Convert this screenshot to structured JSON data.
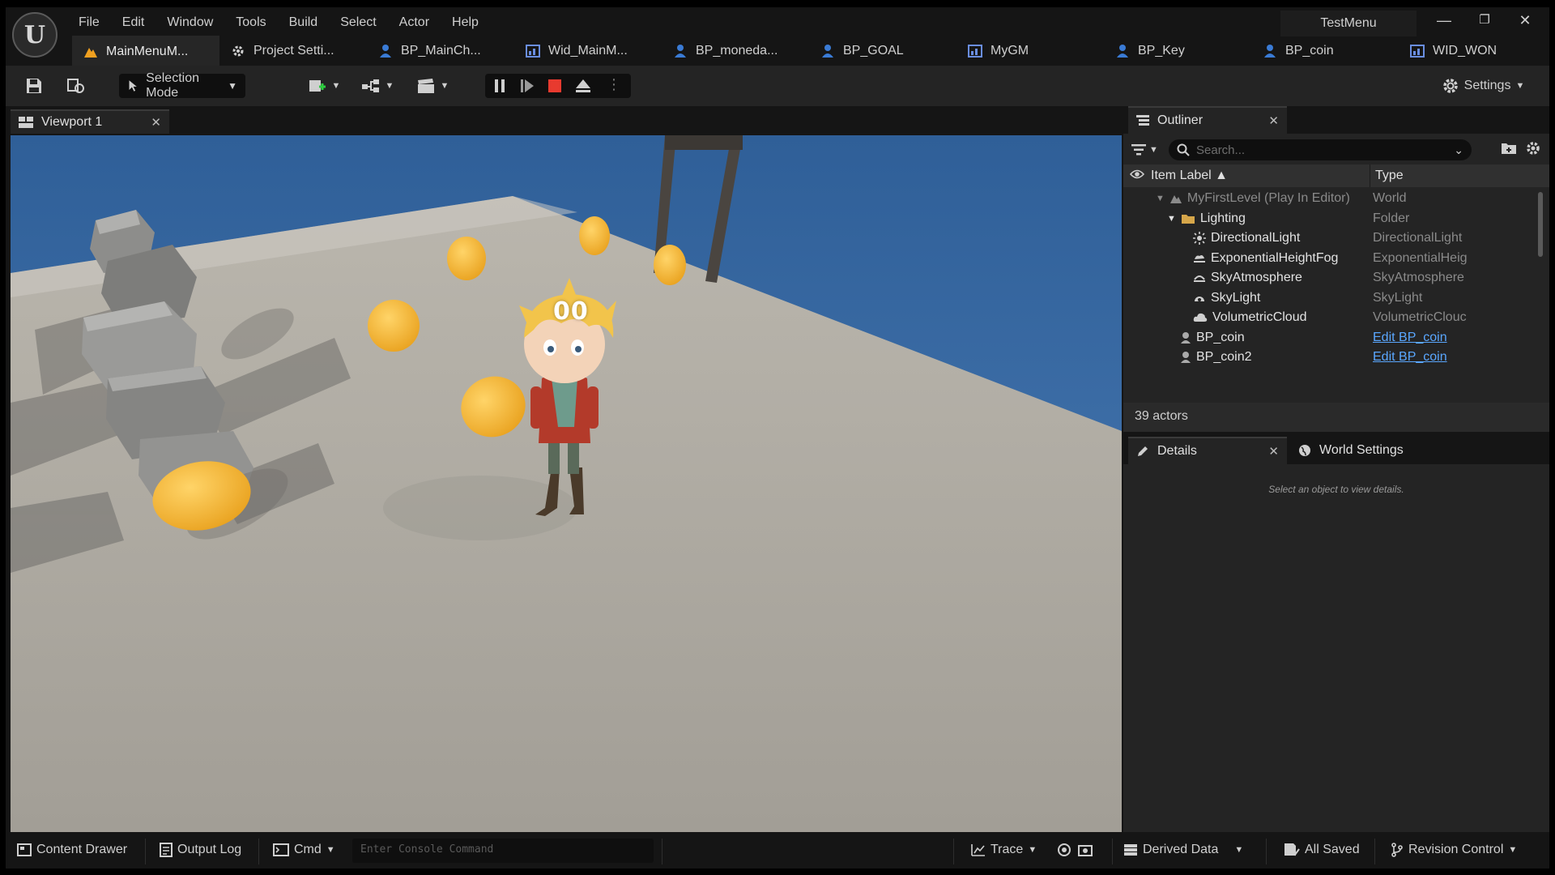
{
  "app": {
    "project_name": "TestMenu",
    "menu": [
      "File",
      "Edit",
      "Window",
      "Tools",
      "Build",
      "Select",
      "Actor",
      "Help"
    ],
    "tabs": [
      {
        "label": "MainMenuM...",
        "icon": "level-icon",
        "active": true
      },
      {
        "label": "Project Setti...",
        "icon": "settings-gear-icon",
        "active": false
      },
      {
        "label": "BP_MainCh...",
        "icon": "blueprint-icon",
        "active": false
      },
      {
        "label": "Wid_MainM...",
        "icon": "widget-icon",
        "active": false
      },
      {
        "label": "BP_moneda...",
        "icon": "blueprint-icon",
        "active": false
      },
      {
        "label": "BP_GOAL",
        "icon": "blueprint-icon",
        "active": false
      },
      {
        "label": "MyGM",
        "icon": "widget-icon",
        "active": false
      },
      {
        "label": "BP_Key",
        "icon": "blueprint-icon",
        "active": false
      },
      {
        "label": "BP_coin",
        "icon": "blueprint-icon",
        "active": false
      },
      {
        "label": "WID_WON",
        "icon": "widget-icon",
        "active": false
      }
    ]
  },
  "toolbar": {
    "selection_mode": "Selection Mode",
    "settings": "Settings"
  },
  "viewport": {
    "tab_label": "Viewport 1",
    "coin_counter": "00"
  },
  "outliner": {
    "tab_label": "Outliner",
    "search_placeholder": "Search...",
    "col_label": "Item Label ▲",
    "col_type": "Type",
    "rows": [
      {
        "label": "MyFirstLevel (Play In Editor)",
        "type": "World",
        "icon": "level-icon",
        "indent": 0,
        "expander": true,
        "dim": true,
        "link": false
      },
      {
        "label": "Lighting",
        "type": "Folder",
        "icon": "folder-icon",
        "indent": 1,
        "expander": true,
        "dim": false,
        "link": false
      },
      {
        "label": "DirectionalLight",
        "type": "DirectionalLight",
        "icon": "sun-icon",
        "indent": 2,
        "expander": false,
        "dim": false,
        "link": false
      },
      {
        "label": "ExponentialHeightFog",
        "type": "ExponentialHeig",
        "icon": "fog-icon",
        "indent": 2,
        "expander": false,
        "dim": false,
        "link": false
      },
      {
        "label": "SkyAtmosphere",
        "type": "SkyAtmosphere",
        "icon": "sky-atmosphere-icon",
        "indent": 2,
        "expander": false,
        "dim": false,
        "link": false
      },
      {
        "label": "SkyLight",
        "type": "SkyLight",
        "icon": "skylight-icon",
        "indent": 2,
        "expander": false,
        "dim": false,
        "link": false
      },
      {
        "label": "VolumetricCloud",
        "type": "VolumetricClouc",
        "icon": "cloud-icon",
        "indent": 2,
        "expander": false,
        "dim": false,
        "link": false
      },
      {
        "label": "BP_coin",
        "type": "Edit BP_coin",
        "icon": "actor-icon",
        "indent": 1,
        "expander": false,
        "dim": false,
        "link": true
      },
      {
        "label": "BP_coin2",
        "type": "Edit BP_coin",
        "icon": "actor-icon",
        "indent": 1,
        "expander": false,
        "dim": false,
        "link": true
      }
    ],
    "actor_count": "39 actors"
  },
  "details": {
    "tab_label": "Details",
    "world_settings_label": "World Settings",
    "empty_hint": "Select an object to view details."
  },
  "statusbar": {
    "content_drawer": "Content Drawer",
    "output_log": "Output Log",
    "cmd": "Cmd",
    "console_placeholder": "Enter Console Command",
    "trace": "Trace",
    "derived_data": "Derived Data",
    "all_saved": "All Saved",
    "revision_control": "Revision Control"
  },
  "colors": {
    "accent_blue": "#5aa7ff",
    "stop_red": "#e83a2f",
    "level_orange": "#f0a020",
    "coin_gold": "#f2b233"
  }
}
